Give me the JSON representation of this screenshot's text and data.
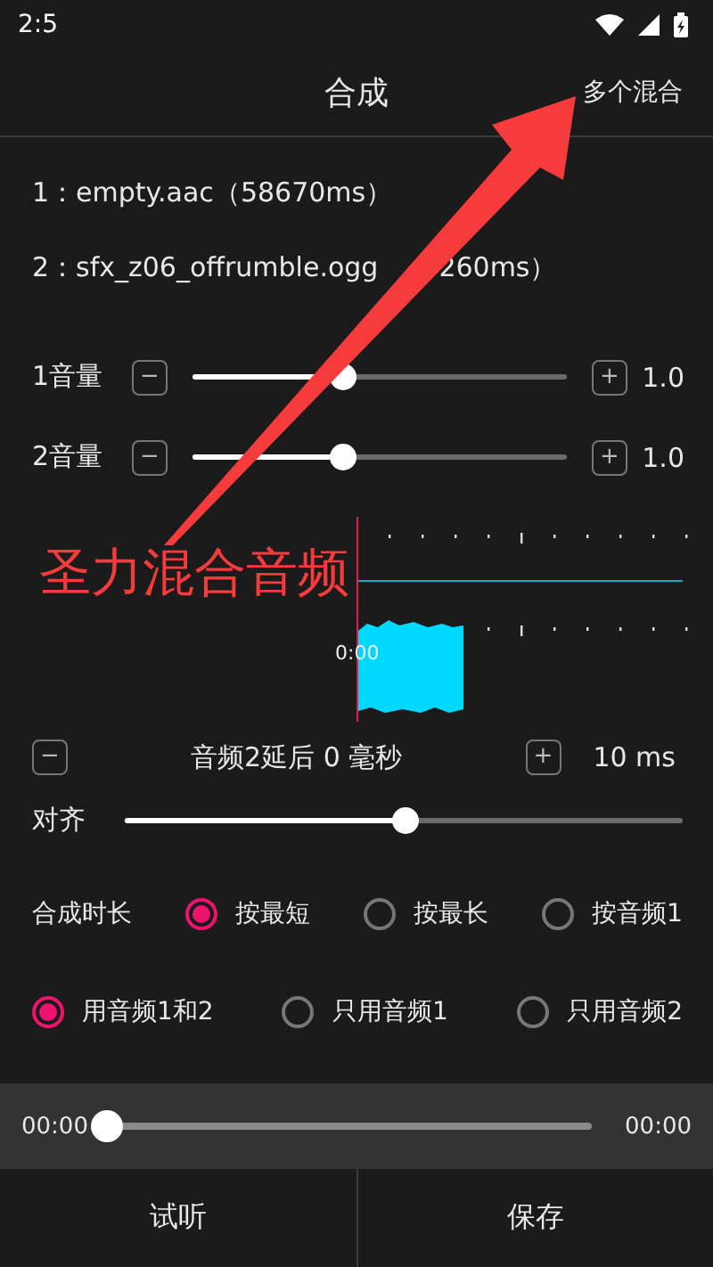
{
  "status_bar": {
    "time": "2:5"
  },
  "header": {
    "title": "合成",
    "action": "多个混合"
  },
  "files": [
    {
      "name": "1：empty.aac",
      "duration": "（58670ms）"
    },
    {
      "name": "2：sfx_z06_offrumble.ogg",
      "duration": "260ms）"
    }
  ],
  "volumes": [
    {
      "label": "1音量",
      "minus": "−",
      "plus": "+",
      "level": 0.4,
      "reading": "1.0"
    },
    {
      "label": "2音量",
      "minus": "−",
      "plus": "+",
      "level": 0.4,
      "reading": "1.0"
    }
  ],
  "waveform": {
    "time_label": "0:00"
  },
  "delay": {
    "minus": "−",
    "text": "音频2延后 0 毫秒",
    "plus": "+",
    "step": "10 ms"
  },
  "align": {
    "label": "对齐",
    "level": 0.5
  },
  "duration": {
    "label": "合成时长",
    "options": [
      {
        "label": "按最短",
        "selected": true
      },
      {
        "label": "按最长",
        "selected": false
      },
      {
        "label": "按音频1",
        "selected": false
      }
    ]
  },
  "sources": [
    {
      "label": "用音频1和2",
      "selected": true
    },
    {
      "label": "只用音频1",
      "selected": false
    },
    {
      "label": "只用音频2",
      "selected": false
    }
  ],
  "player": {
    "current": "00:00",
    "total": "00:00",
    "level": 0
  },
  "buttons": [
    "试听",
    "保存"
  ],
  "annotation": {
    "label": "圣力混合音频"
  }
}
